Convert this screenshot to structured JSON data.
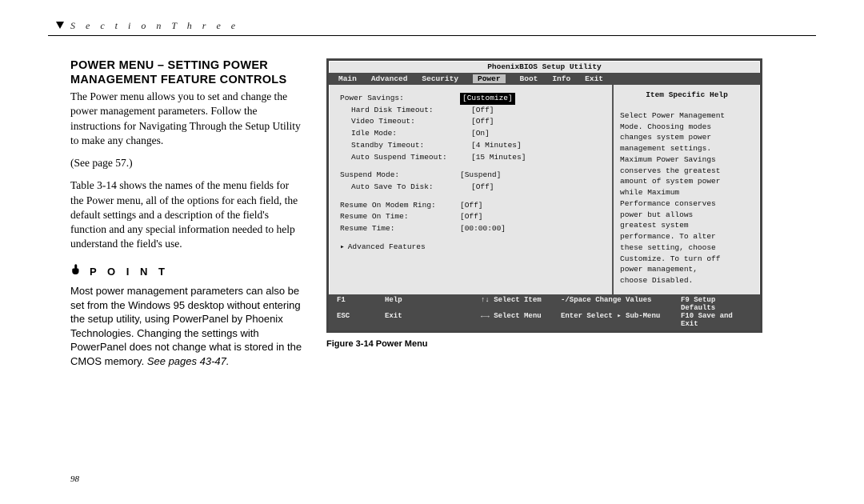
{
  "running_head": "S e c t i o n   T h r e e",
  "heading": "POWER MENU – SETTING POWER MANAGEMENT FEATURE CONTROLS",
  "para1": "The Power menu allows you to set and change the power management parameters. Follow the instructions for Navigating Through the Setup Utility to make any changes.",
  "see_page": "(See page 57.)",
  "para2": "Table 3-14 shows the names of the menu fields for the Power menu, all of the options for each field, the default settings and a description of the field's function and any special information needed to help understand the field's use.",
  "point": {
    "label": "P O I N T",
    "body": "Most power management parameters can also be set from the Windows 95 desktop without entering the setup utility, using PowerPanel by Phoenix Technologies. Changing the settings with PowerPanel does not change what is stored in the CMOS memory. ",
    "ital": "See pages 43-47."
  },
  "figure_caption": "Figure 3-14 Power Menu",
  "page_number": "98",
  "bios": {
    "title": "PhoenixBIOS Setup Utility",
    "menu": [
      "Main",
      "Advanced",
      "Security",
      "Power",
      "Boot",
      "Info",
      "Exit"
    ],
    "active_menu": "Power",
    "groups": [
      {
        "rows": [
          {
            "label": "Power Savings:",
            "value": "[Customize]",
            "hl": true,
            "indent": 0
          },
          {
            "label": "Hard Disk Timeout:",
            "value": "[Off]",
            "indent": 1
          },
          {
            "label": "Video Timeout:",
            "value": "[Off]",
            "indent": 1
          },
          {
            "label": "Idle Mode:",
            "value": "[On]",
            "indent": 1
          },
          {
            "label": "Standby Timeout:",
            "value": "[4 Minutes]",
            "indent": 1
          },
          {
            "label": "Auto Suspend Timeout:",
            "value": "[15 Minutes]",
            "indent": 1
          }
        ]
      },
      {
        "rows": [
          {
            "label": "Suspend Mode:",
            "value": "[Suspend]",
            "indent": 0
          },
          {
            "label": "Auto Save To Disk:",
            "value": "[Off]",
            "indent": 1
          }
        ]
      },
      {
        "rows": [
          {
            "label": "Resume On Modem Ring:",
            "value": "[Off]",
            "indent": 0
          },
          {
            "label": "Resume On Time:",
            "value": "[Off]",
            "indent": 0
          },
          {
            "label": "Resume Time:",
            "value": "[00:00:00]",
            "indent": 0
          }
        ]
      },
      {
        "rows": [
          {
            "label": "Advanced Features",
            "value": "",
            "indent": 0,
            "arrow": true
          }
        ]
      }
    ],
    "help_title": "Item Specific Help",
    "help_lines": [
      "Select Power Management",
      "Mode. Choosing modes",
      "changes system power",
      "management settings.",
      "Maximum Power Savings",
      "conserves the greatest",
      "amount of system power",
      "while Maximum",
      "Performance conserves",
      "power but allows",
      "greatest system",
      "performance. To alter",
      "these setting, choose",
      "Customize. To turn off",
      "power management,",
      "choose Disabled."
    ],
    "footer": {
      "f1": "F1",
      "help": "Help",
      "arrows1": "↑↓",
      "sel_item": "Select Item",
      "space": "-/Space",
      "chg": "Change Values",
      "f9": "F9",
      "defaults": "Setup Defaults",
      "esc": "ESC",
      "exit": "Exit",
      "arrows2": "←→",
      "sel_menu": "Select Menu",
      "enter": "Enter",
      "sub": "Select ▸ Sub-Menu",
      "f10": "F10",
      "save": "Save and Exit"
    }
  }
}
